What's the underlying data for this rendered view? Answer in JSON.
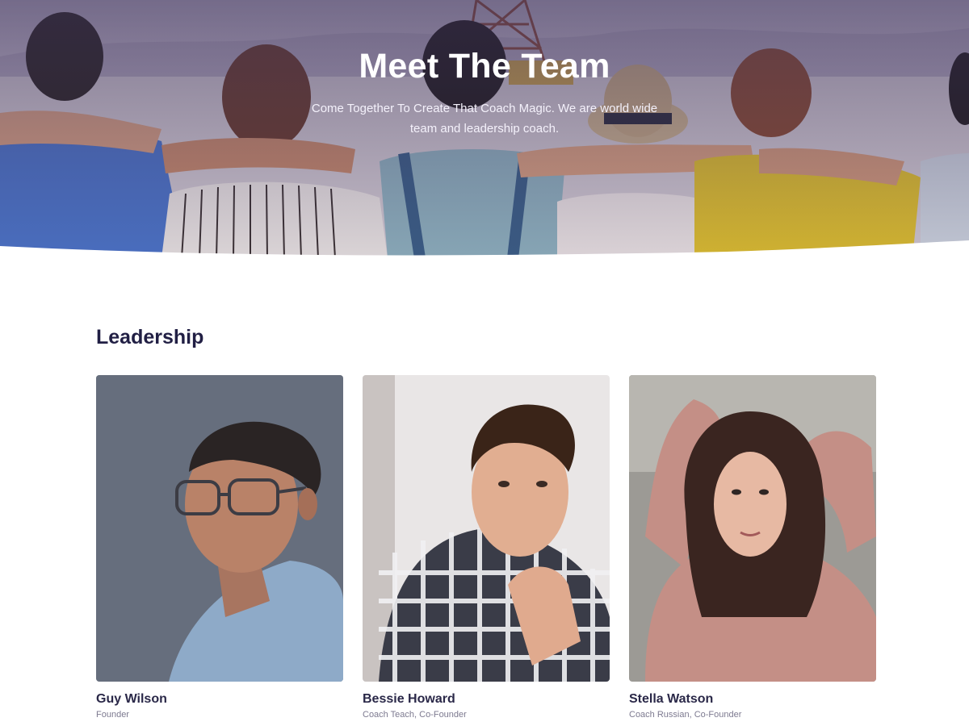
{
  "hero": {
    "title": "Meet The Team",
    "subtitle": "Come Together To Create That Coach Magic. We are world wide team and leadership coach."
  },
  "leadership": {
    "heading": "Leadership",
    "members": [
      {
        "name": "Guy Wilson",
        "role": "Founder"
      },
      {
        "name": "Bessie Howard",
        "role": "Coach Teach, Co-Founder"
      },
      {
        "name": "Stella Watson",
        "role": "Coach Russian, Co-Founder"
      }
    ]
  },
  "colors": {
    "heading": "#211f44",
    "role_text": "#7d7a90",
    "hero_overlay": "#3c325a"
  }
}
